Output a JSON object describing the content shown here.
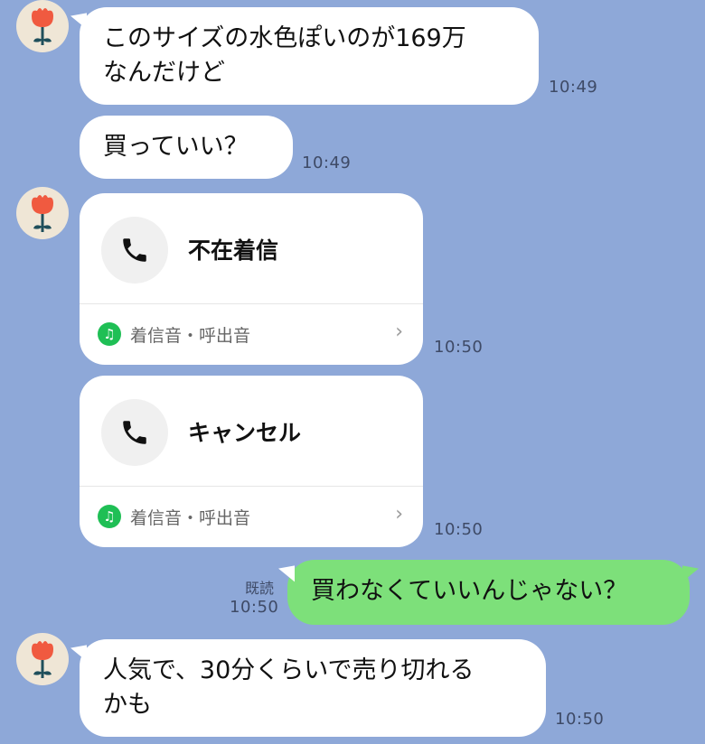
{
  "messages": {
    "m1": {
      "text": "このサイズの水色ぽいのが169万\nなんだけど",
      "time": "10:49"
    },
    "m2": {
      "text": "買っていい？",
      "time": "10:49"
    },
    "call1": {
      "title": "不在着信",
      "footer": "着信音・呼出音",
      "time": "10:50"
    },
    "call2": {
      "title": "キャンセル",
      "footer": "着信音・呼出音",
      "time": "10:50"
    },
    "m3": {
      "text": "買わなくていいんじゃない？",
      "read": "既読",
      "time": "10:50"
    },
    "m4": {
      "text": "人気で、30分くらいで売り切れる\nかも",
      "time": "10:50"
    }
  },
  "icons": {
    "avatar": "red-flower-avatar",
    "phone": "phone-icon",
    "music": "music-note-icon",
    "chevron": "chevron-right-icon"
  },
  "colors": {
    "background": "#8ea8d8",
    "incoming_bubble": "#ffffff",
    "outgoing_bubble": "#7de07a",
    "music_badge": "#1fbf55"
  }
}
